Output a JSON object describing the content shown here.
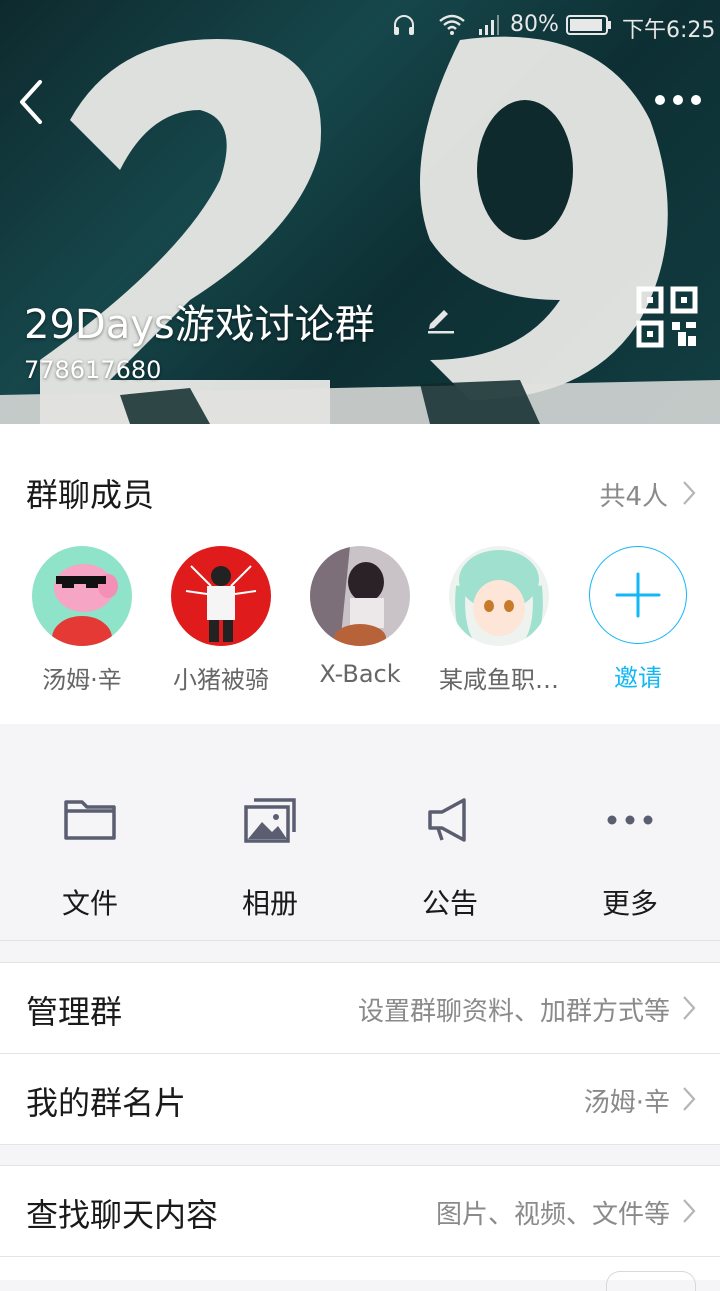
{
  "status_bar": {
    "battery": "80%",
    "time": "下午6:25"
  },
  "header": {
    "group_name": "29Days游戏讨论群",
    "group_id": "778617680"
  },
  "members": {
    "title": "群聊成员",
    "count": "共4人",
    "list": [
      {
        "name": "汤姆·辛"
      },
      {
        "name": "小猪被骑"
      },
      {
        "name": "X-Back"
      },
      {
        "name": "某咸鱼职…"
      }
    ],
    "invite_label": "邀请"
  },
  "actions": [
    {
      "label": "文件",
      "icon": "folder-icon"
    },
    {
      "label": "相册",
      "icon": "album-icon"
    },
    {
      "label": "公告",
      "icon": "megaphone-icon"
    },
    {
      "label": "更多",
      "icon": "more-icon"
    }
  ],
  "settings": {
    "manage": {
      "label": "管理群",
      "value": "设置群聊资料、加群方式等"
    },
    "card": {
      "label": "我的群名片",
      "value": "汤姆·辛"
    },
    "search": {
      "label": "查找聊天内容",
      "value": "图片、视频、文件等"
    }
  },
  "colors": {
    "accent": "#12b7f5",
    "icon_gray": "#5a5e70",
    "header_bg": "#16474b"
  }
}
